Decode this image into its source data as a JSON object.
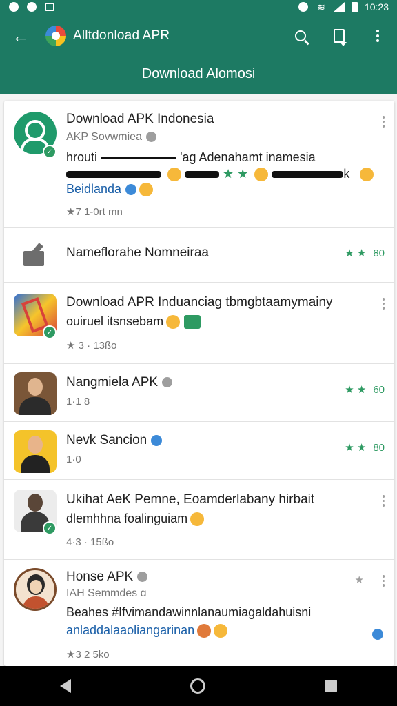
{
  "status": {
    "time": "10:23",
    "colors": {
      "bar": "#1d7a63"
    }
  },
  "appbar": {
    "title": "Alltdonload APR",
    "subtitle": "Download Alomosi",
    "icons": [
      "back-arrow-icon",
      "app-logo-icon",
      "search-icon",
      "download-icon",
      "more-vert-icon"
    ]
  },
  "items": [
    {
      "title": "Download APK Indonesia",
      "sub": "AKP Sovwmiea",
      "body1a": "hrouti",
      "body1b": "'ag Adenahamt",
      "body1c": "inamesia",
      "body2": "k",
      "body3": "Beidlanda",
      "meta": "★7   1-0rt     mn"
    },
    {
      "title": "Nameflorahe Nomneiraa",
      "rating": "80"
    },
    {
      "title": "Download APR Induanciag tbmgbtaamymainy",
      "body": "ouiruel itsnsebam",
      "meta": "★ 3 · 13ßo"
    },
    {
      "title": "Nangmiela APK",
      "meta": "1·1  8",
      "rating": "60"
    },
    {
      "title": "Nevk Sancion",
      "meta": "1·0",
      "rating": "80"
    },
    {
      "title": "Ukihat AeK Pemne, Eoamderlabany hirbait",
      "body": "dlemhhna foalinguiam",
      "meta": "4·3 · 15ßo"
    },
    {
      "title": "Honse APK",
      "sub": "IAH Semmdes",
      "body1": "Beahes #Ifvimandawinnlanaumiagaldahuisni",
      "body2": "anladdalaaoliangarinan",
      "meta": "★3   2 5ko"
    }
  ]
}
